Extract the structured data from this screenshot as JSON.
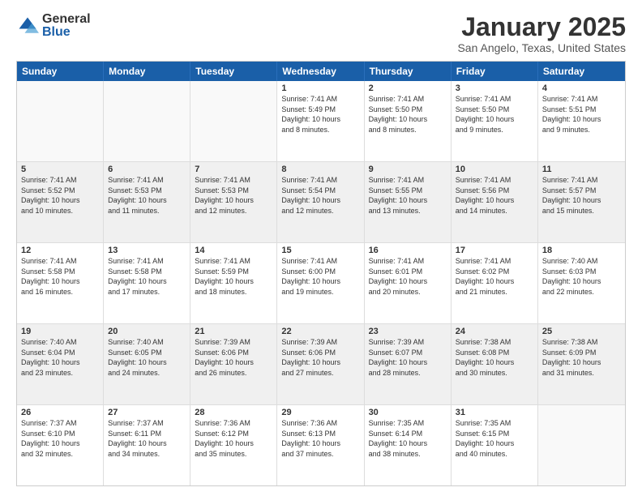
{
  "logo": {
    "general": "General",
    "blue": "Blue"
  },
  "title": "January 2025",
  "subtitle": "San Angelo, Texas, United States",
  "headers": [
    "Sunday",
    "Monday",
    "Tuesday",
    "Wednesday",
    "Thursday",
    "Friday",
    "Saturday"
  ],
  "weeks": [
    [
      {
        "day": "",
        "lines": [],
        "empty": true
      },
      {
        "day": "",
        "lines": [],
        "empty": true
      },
      {
        "day": "",
        "lines": [],
        "empty": true
      },
      {
        "day": "1",
        "lines": [
          "Sunrise: 7:41 AM",
          "Sunset: 5:49 PM",
          "Daylight: 10 hours",
          "and 8 minutes."
        ]
      },
      {
        "day": "2",
        "lines": [
          "Sunrise: 7:41 AM",
          "Sunset: 5:50 PM",
          "Daylight: 10 hours",
          "and 8 minutes."
        ]
      },
      {
        "day": "3",
        "lines": [
          "Sunrise: 7:41 AM",
          "Sunset: 5:50 PM",
          "Daylight: 10 hours",
          "and 9 minutes."
        ]
      },
      {
        "day": "4",
        "lines": [
          "Sunrise: 7:41 AM",
          "Sunset: 5:51 PM",
          "Daylight: 10 hours",
          "and 9 minutes."
        ]
      }
    ],
    [
      {
        "day": "5",
        "lines": [
          "Sunrise: 7:41 AM",
          "Sunset: 5:52 PM",
          "Daylight: 10 hours",
          "and 10 minutes."
        ]
      },
      {
        "day": "6",
        "lines": [
          "Sunrise: 7:41 AM",
          "Sunset: 5:53 PM",
          "Daylight: 10 hours",
          "and 11 minutes."
        ]
      },
      {
        "day": "7",
        "lines": [
          "Sunrise: 7:41 AM",
          "Sunset: 5:53 PM",
          "Daylight: 10 hours",
          "and 12 minutes."
        ]
      },
      {
        "day": "8",
        "lines": [
          "Sunrise: 7:41 AM",
          "Sunset: 5:54 PM",
          "Daylight: 10 hours",
          "and 12 minutes."
        ]
      },
      {
        "day": "9",
        "lines": [
          "Sunrise: 7:41 AM",
          "Sunset: 5:55 PM",
          "Daylight: 10 hours",
          "and 13 minutes."
        ]
      },
      {
        "day": "10",
        "lines": [
          "Sunrise: 7:41 AM",
          "Sunset: 5:56 PM",
          "Daylight: 10 hours",
          "and 14 minutes."
        ]
      },
      {
        "day": "11",
        "lines": [
          "Sunrise: 7:41 AM",
          "Sunset: 5:57 PM",
          "Daylight: 10 hours",
          "and 15 minutes."
        ]
      }
    ],
    [
      {
        "day": "12",
        "lines": [
          "Sunrise: 7:41 AM",
          "Sunset: 5:58 PM",
          "Daylight: 10 hours",
          "and 16 minutes."
        ]
      },
      {
        "day": "13",
        "lines": [
          "Sunrise: 7:41 AM",
          "Sunset: 5:58 PM",
          "Daylight: 10 hours",
          "and 17 minutes."
        ]
      },
      {
        "day": "14",
        "lines": [
          "Sunrise: 7:41 AM",
          "Sunset: 5:59 PM",
          "Daylight: 10 hours",
          "and 18 minutes."
        ]
      },
      {
        "day": "15",
        "lines": [
          "Sunrise: 7:41 AM",
          "Sunset: 6:00 PM",
          "Daylight: 10 hours",
          "and 19 minutes."
        ]
      },
      {
        "day": "16",
        "lines": [
          "Sunrise: 7:41 AM",
          "Sunset: 6:01 PM",
          "Daylight: 10 hours",
          "and 20 minutes."
        ]
      },
      {
        "day": "17",
        "lines": [
          "Sunrise: 7:41 AM",
          "Sunset: 6:02 PM",
          "Daylight: 10 hours",
          "and 21 minutes."
        ]
      },
      {
        "day": "18",
        "lines": [
          "Sunrise: 7:40 AM",
          "Sunset: 6:03 PM",
          "Daylight: 10 hours",
          "and 22 minutes."
        ]
      }
    ],
    [
      {
        "day": "19",
        "lines": [
          "Sunrise: 7:40 AM",
          "Sunset: 6:04 PM",
          "Daylight: 10 hours",
          "and 23 minutes."
        ]
      },
      {
        "day": "20",
        "lines": [
          "Sunrise: 7:40 AM",
          "Sunset: 6:05 PM",
          "Daylight: 10 hours",
          "and 24 minutes."
        ]
      },
      {
        "day": "21",
        "lines": [
          "Sunrise: 7:39 AM",
          "Sunset: 6:06 PM",
          "Daylight: 10 hours",
          "and 26 minutes."
        ]
      },
      {
        "day": "22",
        "lines": [
          "Sunrise: 7:39 AM",
          "Sunset: 6:06 PM",
          "Daylight: 10 hours",
          "and 27 minutes."
        ]
      },
      {
        "day": "23",
        "lines": [
          "Sunrise: 7:39 AM",
          "Sunset: 6:07 PM",
          "Daylight: 10 hours",
          "and 28 minutes."
        ]
      },
      {
        "day": "24",
        "lines": [
          "Sunrise: 7:38 AM",
          "Sunset: 6:08 PM",
          "Daylight: 10 hours",
          "and 30 minutes."
        ]
      },
      {
        "day": "25",
        "lines": [
          "Sunrise: 7:38 AM",
          "Sunset: 6:09 PM",
          "Daylight: 10 hours",
          "and 31 minutes."
        ]
      }
    ],
    [
      {
        "day": "26",
        "lines": [
          "Sunrise: 7:37 AM",
          "Sunset: 6:10 PM",
          "Daylight: 10 hours",
          "and 32 minutes."
        ]
      },
      {
        "day": "27",
        "lines": [
          "Sunrise: 7:37 AM",
          "Sunset: 6:11 PM",
          "Daylight: 10 hours",
          "and 34 minutes."
        ]
      },
      {
        "day": "28",
        "lines": [
          "Sunrise: 7:36 AM",
          "Sunset: 6:12 PM",
          "Daylight: 10 hours",
          "and 35 minutes."
        ]
      },
      {
        "day": "29",
        "lines": [
          "Sunrise: 7:36 AM",
          "Sunset: 6:13 PM",
          "Daylight: 10 hours",
          "and 37 minutes."
        ]
      },
      {
        "day": "30",
        "lines": [
          "Sunrise: 7:35 AM",
          "Sunset: 6:14 PM",
          "Daylight: 10 hours",
          "and 38 minutes."
        ]
      },
      {
        "day": "31",
        "lines": [
          "Sunrise: 7:35 AM",
          "Sunset: 6:15 PM",
          "Daylight: 10 hours",
          "and 40 minutes."
        ]
      },
      {
        "day": "",
        "lines": [],
        "empty": true
      }
    ]
  ]
}
